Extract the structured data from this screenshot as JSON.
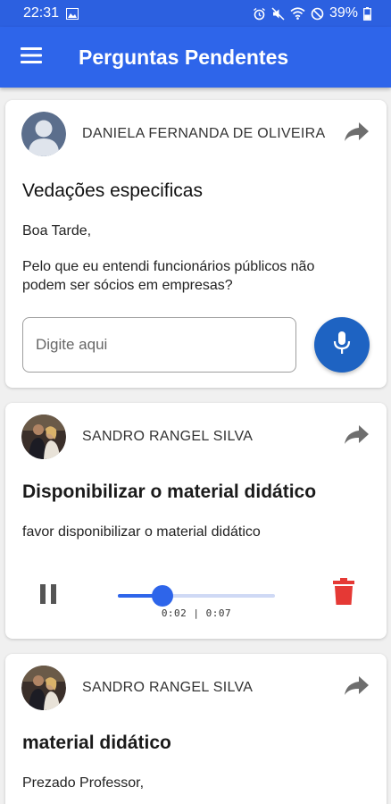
{
  "status_bar": {
    "time": "22:31",
    "battery": "39%"
  },
  "app_bar": {
    "title": "Perguntas Pendentes"
  },
  "questions": [
    {
      "author": "DANIELA FERNANDA DE OLIVEIRA",
      "title": "Vedações especificas",
      "body": [
        "Boa Tarde,",
        "Pelo que eu entendi funcionários públicos  não podem ser sócios em empresas?"
      ],
      "reply_placeholder": "Digite aqui"
    },
    {
      "author": "SANDRO RANGEL SILVA",
      "title": "Disponibilizar o material didático",
      "body": [
        "favor disponibilizar o material didático"
      ],
      "audio": {
        "current": "0:02",
        "total": "0:07",
        "time_label": "0:02 | 0:07",
        "progress": 0.2857
      }
    },
    {
      "author": "SANDRO RANGEL SILVA",
      "title": "material didático",
      "body": [
        "Prezado Professor,"
      ]
    }
  ],
  "colors": {
    "primary": "#2e65ea",
    "status_bar": "#2c60e0",
    "mic_button": "#1e63c2",
    "delete": "#e53935",
    "icon_grey": "#757575"
  }
}
